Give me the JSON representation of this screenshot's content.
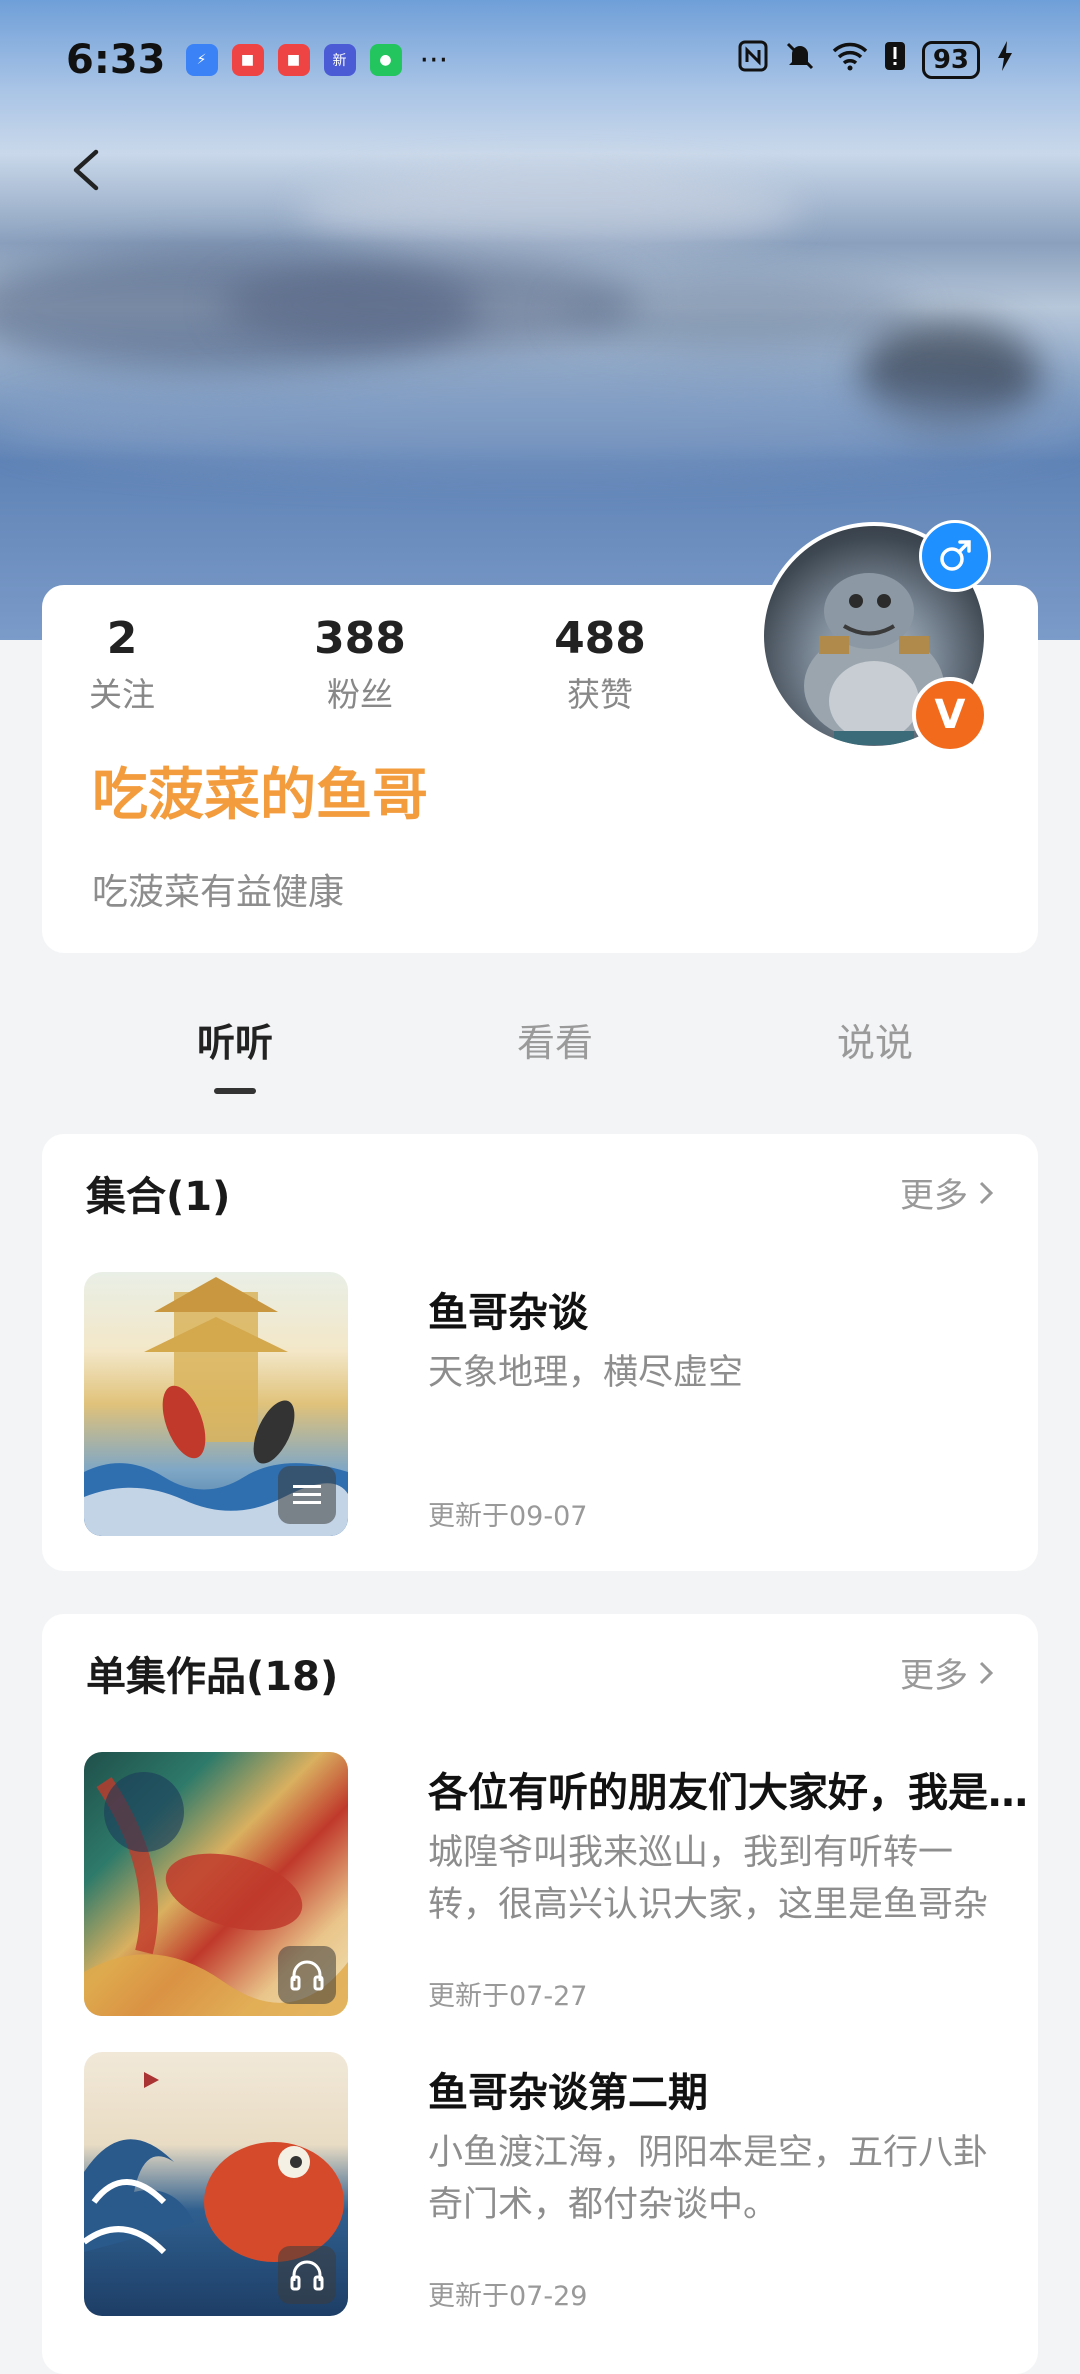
{
  "status_bar": {
    "time": "6:33",
    "more": "···",
    "battery": "93",
    "icons": [
      "usb-icon",
      "huawei-app-icon",
      "huawei-app-icon",
      "sina-news-icon",
      "wechat-icon",
      "nfc-icon",
      "mute-icon",
      "wifi-icon",
      "alert-icon",
      "charging-icon"
    ]
  },
  "profile": {
    "stats": [
      {
        "value": "2",
        "label": "关注"
      },
      {
        "value": "388",
        "label": "粉丝"
      },
      {
        "value": "488",
        "label": "获赞"
      }
    ],
    "name": "吃菠菜的鱼哥",
    "bio": "吃菠菜有益健康",
    "vip_badge": "V",
    "gender": "male"
  },
  "tabs": [
    {
      "label": "听听",
      "active": true
    },
    {
      "label": "看看",
      "active": false
    },
    {
      "label": "说说",
      "active": false
    }
  ],
  "collections": {
    "title": "集合(1)",
    "more": "更多",
    "items": [
      {
        "title": "鱼哥杂谈",
        "desc": "天象地理，横尽虚空",
        "date": "更新于09-07",
        "badge_icon": "list-icon"
      }
    ]
  },
  "episodes": {
    "title": "单集作品(18)",
    "more": "更多",
    "items": [
      {
        "title": "各位有听的朋友们大家好，我是鱼哥",
        "desc": "城隍爷叫我来巡山，我到有听转一转，很高兴认识大家，这里是鱼哥杂谈",
        "date": "更新于07-27",
        "badge_icon": "headphones-icon"
      },
      {
        "title": "鱼哥杂谈第二期",
        "desc": "小鱼渡江海，阴阳本是空，五行八卦奇门术，都付杂谈中。",
        "date": "更新于07-29",
        "badge_icon": "headphones-icon"
      }
    ]
  },
  "colors": {
    "accent_name": "#f39c3e",
    "vip_badge": "#f26b1d",
    "gender_badge": "#1e90ff"
  }
}
